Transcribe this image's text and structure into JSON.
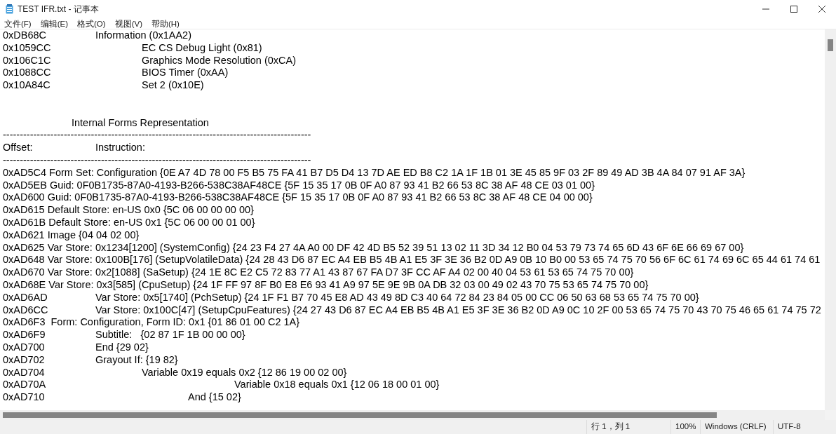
{
  "window": {
    "title": "TEST IFR.txt - 记事本"
  },
  "menu": [
    "文件(F)",
    "编辑(E)",
    "格式(O)",
    "视图(V)",
    "帮助(H)"
  ],
  "lines": [
    {
      "kind": "entry",
      "offset": "0xDB68C",
      "text": "Information (0x1AA2)"
    },
    {
      "kind": "entry",
      "offset": "0x1059CC",
      "text": "\tEC CS Debug Light (0x81)"
    },
    {
      "kind": "entry",
      "offset": "0x106C1C",
      "text": "\tGraphics Mode Resolution (0xCA)"
    },
    {
      "kind": "entry",
      "offset": "0x1088CC",
      "text": "\tBIOS Timer (0xAA)"
    },
    {
      "kind": "entry",
      "offset": "0x10A84C",
      "text": "\tSet 2 (0x10E)"
    },
    {
      "kind": "blank"
    },
    {
      "kind": "blank"
    },
    {
      "kind": "heading",
      "text": "Internal Forms Representation"
    },
    {
      "kind": "rule",
      "text": "-------------------------------------------------------------------------------------------"
    },
    {
      "kind": "entry",
      "offset": "Offset:",
      "text": "Instruction:"
    },
    {
      "kind": "rule",
      "text": "-------------------------------------------------------------------------------------------"
    },
    {
      "kind": "line",
      "text": "0xAD5C4 Form Set: Configuration {0E A7 4D 78 00 F5 B5 75 FA 41 B7 D5 D4 13 7D AE ED B8 C2 1A 1F 1B 01 3E 45 85 9F 03 2F 89 49 AD 3B 4A 84 07 91 AF 3A}"
    },
    {
      "kind": "line",
      "text": "0xAD5EB Guid: 0F0B1735-87A0-4193-B266-538C38AF48CE {5F 15 35 17 0B 0F A0 87 93 41 B2 66 53 8C 38 AF 48 CE 03 01 00}"
    },
    {
      "kind": "line",
      "text": "0xAD600 Guid: 0F0B1735-87A0-4193-B266-538C38AF48CE {5F 15 35 17 0B 0F A0 87 93 41 B2 66 53 8C 38 AF 48 CE 04 00 00}"
    },
    {
      "kind": "line",
      "text": "0xAD615 Default Store: en-US 0x0 {5C 06 00 00 00 00}"
    },
    {
      "kind": "line",
      "text": "0xAD61B Default Store: en-US 0x1 {5C 06 00 00 01 00}"
    },
    {
      "kind": "line",
      "text": "0xAD621 Image {04 04 02 00}"
    },
    {
      "kind": "line",
      "text": "0xAD625 Var Store: 0x1234[1200] (SystemConfig) {24 23 F4 27 4A A0 00 DF 42 4D B5 52 39 51 13 02 11 3D 34 12 B0 04 53 79 73 74 65 6D 43 6F 6E 66 69 67 00}"
    },
    {
      "kind": "line",
      "text": "0xAD648 Var Store: 0x100B[176] (SetupVolatileData) {24 28 43 D6 87 EC A4 EB B5 4B A1 E5 3F 3E 36 B2 0D A9 0B 10 B0 00 53 65 74 75 70 56 6F 6C 61 74 69 6C 65 44 61 74 61"
    },
    {
      "kind": "line",
      "text": "0xAD670 Var Store: 0x2[1088] (SaSetup) {24 1E 8C E2 C5 72 83 77 A1 43 87 67 FA D7 3F CC AF A4 02 00 40 04 53 61 53 65 74 75 70 00}"
    },
    {
      "kind": "line",
      "text": "0xAD68E Var Store: 0x3[585] (CpuSetup) {24 1F FF 97 8F B0 E8 E6 93 41 A9 97 5E 9E 9B 0A DB 32 03 00 49 02 43 70 75 53 65 74 75 70 00}"
    },
    {
      "kind": "entry",
      "offset": "0xAD6AD",
      "text": "Var Store: 0x5[1740] (PchSetup) {24 1F F1 B7 70 45 E8 AD 43 49 8D C3 40 64 72 84 23 84 05 00 CC 06 50 63 68 53 65 74 75 70 00}"
    },
    {
      "kind": "entry",
      "offset": "0xAD6CC",
      "text": "Var Store: 0x100C[47] (SetupCpuFeatures) {24 27 43 D6 87 EC A4 EB B5 4B A1 E5 3F 3E 36 B2 0D A9 0C 10 2F 00 53 65 74 75 70 43 70 75 46 65 61 74 75 72"
    },
    {
      "kind": "line",
      "text": "0xAD6F3  Form: Configuration, Form ID: 0x1 {01 86 01 00 C2 1A}"
    },
    {
      "kind": "entry",
      "offset": "0xAD6F9",
      "text": "Subtitle:   {02 87 1F 1B 00 00 00}"
    },
    {
      "kind": "entry",
      "offset": "0xAD700",
      "text": "End {29 02}"
    },
    {
      "kind": "entry",
      "offset": "0xAD702",
      "text": "Grayout If: {19 82}"
    },
    {
      "kind": "entry",
      "offset": "0xAD704",
      "text": "\tVariable 0x19 equals 0x2 {12 86 19 00 02 00}"
    },
    {
      "kind": "entry",
      "offset": "0xAD70A",
      "text": "\t\t\tVariable 0x18 equals 0x1 {12 06 18 00 01 00}"
    },
    {
      "kind": "entry",
      "offset": "0xAD710",
      "text": "\t\tAnd {15 02}"
    }
  ],
  "status_bar": [
    "行 1，列 1",
    "100%",
    "Windows (CRLF)",
    "UTF-8"
  ]
}
